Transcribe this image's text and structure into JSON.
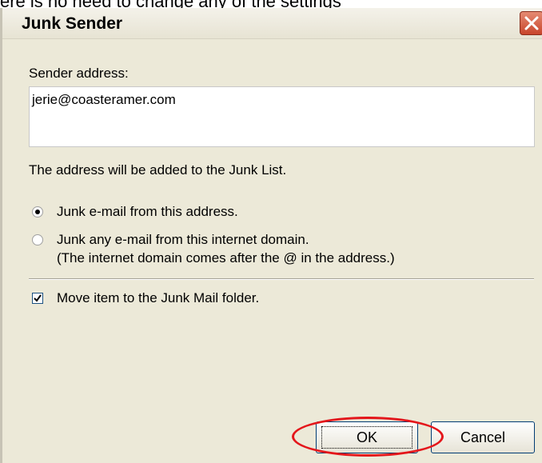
{
  "caption": "ere is no need to change any of the settings",
  "dialog": {
    "title": "Junk Sender",
    "sender_label": "Sender address:",
    "sender_value": "jerie@coasteramer.com",
    "info_text": "The address will be added to the Junk List.",
    "radio_address_label": "Junk e-mail from this address.",
    "radio_domain_label": "Junk any e-mail from this internet domain.",
    "radio_domain_note": "(The internet domain comes after the @ in the address.)",
    "radio_selected": "address",
    "checkbox_label": "Move item to the Junk Mail folder.",
    "checkbox_checked": true,
    "ok_label": "OK",
    "cancel_label": "Cancel"
  },
  "icons": {
    "close": "close-x-icon",
    "check": "checkmark-icon"
  },
  "colors": {
    "highlight_ring": "#e4161b",
    "dialog_bg": "#ece9d8",
    "close_button": "#c8452b"
  }
}
